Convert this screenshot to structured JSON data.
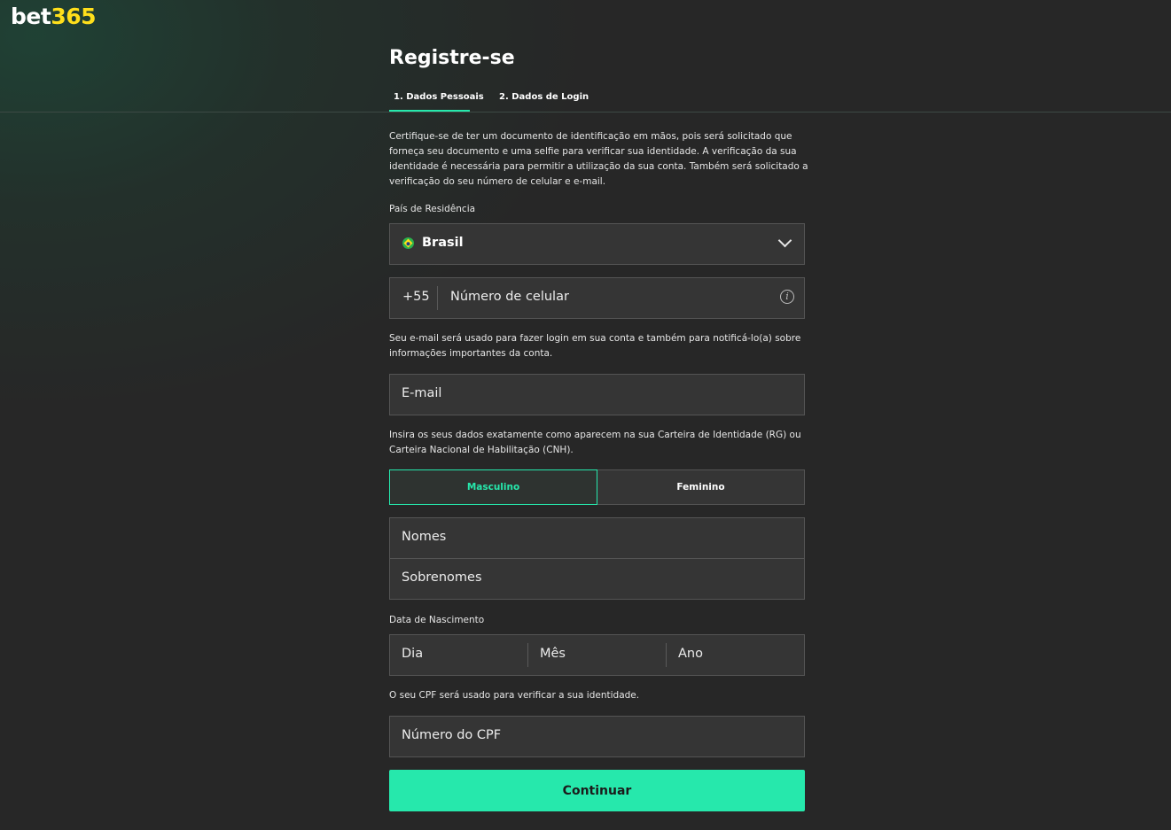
{
  "brand": {
    "logo_part1": "bet",
    "logo_part2": "365"
  },
  "page": {
    "title": "Registre-se",
    "tabs": [
      {
        "label": "1.  Dados Pessoais",
        "active": true
      },
      {
        "label": "2.  Dados de Login",
        "active": false
      }
    ]
  },
  "form": {
    "intro_text": "Certifique-se de ter um documento de identificação em mãos, pois será solicitado que forneça seu documento e uma selfie para verificar sua identidade. A verificação da sua identidade é necessária para permitir a utilização da sua conta. Também será solicitado a verificação do seu número de celular e e-mail.",
    "country_label": "País de Residência",
    "country_value": "Brasil",
    "phone_prefix": "+55",
    "phone_placeholder": "Número de celular",
    "email_note": "Seu e-mail será usado para fazer login em sua conta e também para notificá-lo(a) sobre informações importantes da conta.",
    "email_placeholder": "E-mail",
    "id_note": "Insira os seus dados exatamente como aparecem na sua Carteira de Identidade (RG) ou Carteira Nacional de Habilitação (CNH).",
    "gender_options": [
      {
        "label": "Masculino",
        "selected": true
      },
      {
        "label": "Feminino",
        "selected": false
      }
    ],
    "first_names_placeholder": "Nomes",
    "last_names_placeholder": "Sobrenomes",
    "dob_label": "Data de Nascimento",
    "dob_day": "Dia",
    "dob_month": "Mês",
    "dob_year": "Ano",
    "cpf_note": "O seu CPF será usado para verificar a sua identidade.",
    "cpf_placeholder": "Número do CPF",
    "continue_label": "Continuar"
  },
  "colors": {
    "background": "#272727",
    "accent": "#26e8ac",
    "logo_yellow": "#ffdf1b",
    "field_bg": "#353535"
  },
  "icons": [
    "brazil-flag-icon",
    "chevron-down-icon",
    "info-icon"
  ]
}
